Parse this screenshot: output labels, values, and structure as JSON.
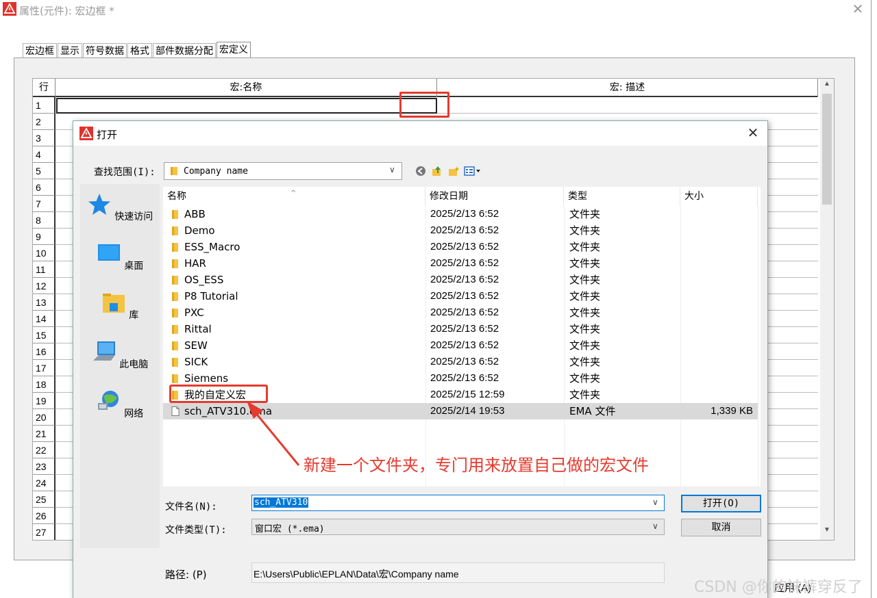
{
  "background_window": {
    "title": "属性(元件): 宏边框 *",
    "tabs": [
      "宏边框",
      "显示",
      "符号数据",
      "格式",
      "部件数据分配",
      "宏定义"
    ],
    "active_tab": "宏定义",
    "grid": {
      "row_header": "行",
      "columns": [
        "宏:名称",
        "宏: 描述"
      ],
      "row_numbers": [
        "1",
        "2",
        "3",
        "4",
        "5",
        "6",
        "7",
        "8",
        "9",
        "10",
        "11",
        "12",
        "13",
        "14",
        "15",
        "16",
        "17",
        "18",
        "19",
        "20",
        "21",
        "22",
        "23",
        "24",
        "25",
        "26",
        "27"
      ]
    },
    "apply_label": "应用 (A)"
  },
  "dialog": {
    "title": "打开",
    "look_in_label": "查找范围(I):",
    "look_in_value": "Company name",
    "places": [
      {
        "label": "快速访问",
        "icon": "star-icon"
      },
      {
        "label": "桌面",
        "icon": "desktop-icon"
      },
      {
        "label": "库",
        "icon": "library-icon"
      },
      {
        "label": "此电脑",
        "icon": "computer-icon"
      },
      {
        "label": "网络",
        "icon": "network-icon"
      }
    ],
    "columns": [
      "名称",
      "修改日期",
      "类型",
      "大小"
    ],
    "files": [
      {
        "name": "ABB",
        "date": "2025/2/13 6:52",
        "type": "文件夹",
        "size": "",
        "kind": "folder"
      },
      {
        "name": "Demo",
        "date": "2025/2/13 6:52",
        "type": "文件夹",
        "size": "",
        "kind": "folder"
      },
      {
        "name": "ESS_Macro",
        "date": "2025/2/13 6:52",
        "type": "文件夹",
        "size": "",
        "kind": "folder"
      },
      {
        "name": "HAR",
        "date": "2025/2/13 6:52",
        "type": "文件夹",
        "size": "",
        "kind": "folder"
      },
      {
        "name": "OS_ESS",
        "date": "2025/2/13 6:52",
        "type": "文件夹",
        "size": "",
        "kind": "folder"
      },
      {
        "name": "P8 Tutorial",
        "date": "2025/2/13 6:52",
        "type": "文件夹",
        "size": "",
        "kind": "folder"
      },
      {
        "name": "PXC",
        "date": "2025/2/13 6:52",
        "type": "文件夹",
        "size": "",
        "kind": "folder"
      },
      {
        "name": "Rittal",
        "date": "2025/2/13 6:52",
        "type": "文件夹",
        "size": "",
        "kind": "folder"
      },
      {
        "name": "SEW",
        "date": "2025/2/13 6:52",
        "type": "文件夹",
        "size": "",
        "kind": "folder"
      },
      {
        "name": "SICK",
        "date": "2025/2/13 6:52",
        "type": "文件夹",
        "size": "",
        "kind": "folder"
      },
      {
        "name": "Siemens",
        "date": "2025/2/13 6:52",
        "type": "文件夹",
        "size": "",
        "kind": "folder"
      },
      {
        "name": "我的自定义宏",
        "date": "2025/2/15 12:59",
        "type": "文件夹",
        "size": "",
        "kind": "folder"
      },
      {
        "name": "sch_ATV310.ema",
        "date": "2025/2/14 19:53",
        "type": "EMA 文件",
        "size": "1,339 KB",
        "kind": "file"
      }
    ],
    "filename_label": "文件名(N):",
    "filename_value": "sch_ATV310",
    "filetype_label": "文件类型(T):",
    "filetype_value": "窗口宏 (*.ema)",
    "open_label": "打开(O)",
    "cancel_label": "取消",
    "path_label": "路径: (P)",
    "path_value": "E:\\Users\\Public\\EPLAN\\Data\\宏\\Company name"
  },
  "annotation": "新建一个文件夹，专门用来放置自己做的宏文件",
  "watermark": "CSDN @你的袜裤穿反了",
  "colors": {
    "highlight_red": "#e53a2e",
    "selection_blue": "#0078d7",
    "folder_yellow": "#f5c342"
  }
}
